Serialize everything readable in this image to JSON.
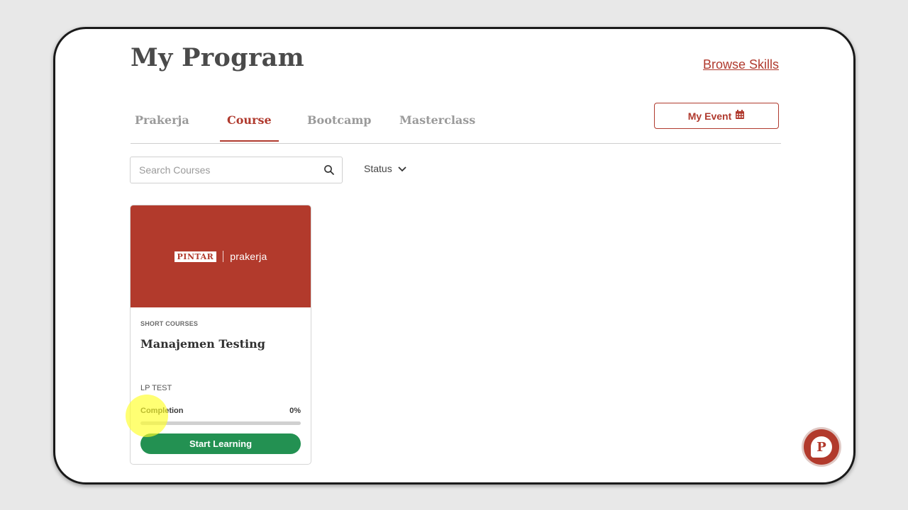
{
  "header": {
    "title": "My Program",
    "browse_link": "Browse Skills"
  },
  "tabs": [
    {
      "label": "Prakerja",
      "active": false
    },
    {
      "label": "Course",
      "active": true
    },
    {
      "label": "Bootcamp",
      "active": false
    },
    {
      "label": "Masterclass",
      "active": false
    }
  ],
  "event_button": {
    "label": "My Event",
    "icon": "calendar-icon"
  },
  "search": {
    "placeholder": "Search Courses",
    "value": "",
    "icon": "search-icon"
  },
  "status_filter": {
    "label": "Status",
    "icon": "chevron-down-icon"
  },
  "course_card": {
    "banner_logo_left": "PINTAR",
    "banner_logo_right": "prakerja",
    "category": "SHORT COURSES",
    "title": "Manajemen Testing",
    "provider": "LP TEST",
    "completion_label": "Completion",
    "completion_value": "0%",
    "completion_fraction": 0,
    "button_label": "Start Learning"
  },
  "chat_button": {
    "icon": "pintar-chat-icon",
    "glyph": "P"
  },
  "colors": {
    "accent": "#b03a2e",
    "success": "#239152",
    "banner": "#b23a2c"
  }
}
